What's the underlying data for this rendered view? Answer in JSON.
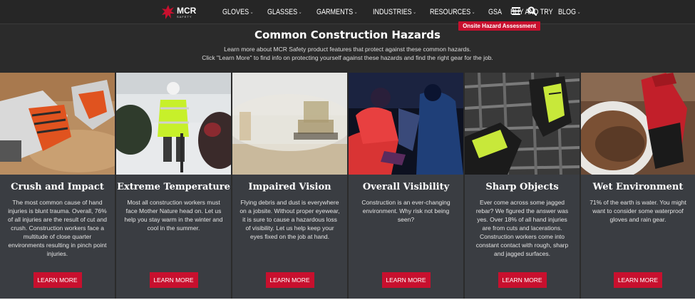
{
  "nav": {
    "logo": {
      "main": "MCR",
      "sub": "SAFETY"
    },
    "items": [
      {
        "label": "GLOVES",
        "has_dropdown": true
      },
      {
        "label": "GLASSES",
        "has_dropdown": true
      },
      {
        "label": "GARMENTS",
        "has_dropdown": true
      },
      {
        "label": "INDUSTRIES",
        "has_dropdown": true
      },
      {
        "label": "RESOURCES",
        "has_dropdown": true
      },
      {
        "label": "GSA",
        "has_dropdown": false
      },
      {
        "label": "BUY AND TRY",
        "has_dropdown": false
      },
      {
        "label": "BLOG",
        "has_dropdown": true
      }
    ],
    "icons": [
      "hamburger-menu-icon",
      "search-icon"
    ],
    "onsite_button": "Onsite Hazard Assessment"
  },
  "header": {
    "title": "Common Construction Hazards",
    "subtitle_1": "Learn more about MCR Safety product features that protect against these common hazards.",
    "subtitle_2": "Click \"Learn More\" to find info on protecting yourself against these hazards and find the right gear for the job."
  },
  "cards": [
    {
      "title": "Crush and Impact",
      "desc": "The most common cause of hand injuries is blunt trauma. Overall, 76% of all injuries are the result of cut and crush. Construction workers face a multitude of close quarter environments resulting in pinch point injuries.",
      "button": "LEARN MORE"
    },
    {
      "title": "Extreme Temperature",
      "desc": "Most all construction workers must face Mother Nature head on. Let us help you stay warm in the winter and cool in the summer.",
      "button": "LEARN MORE"
    },
    {
      "title": "Impaired Vision",
      "desc": "Flying debris and dust is everywhere on a jobsite. Without proper eyewear, it is sure to cause a hazardous loss of visibility. Let us help keep your eyes fixed on the job at hand.",
      "button": "LEARN MORE"
    },
    {
      "title": "Overall Visibility",
      "desc": "Construction is an ever-changing environment. Why risk not being seen?",
      "button": "LEARN MORE"
    },
    {
      "title": "Sharp Objects",
      "desc": "Ever come across some jagged rebar? We figured the answer was yes. Over 18% of all hand injuries are from cuts and lacerations. Construction workers come into constant contact with rough, sharp and jagged surfaces.",
      "button": "LEARN MORE"
    },
    {
      "title": "Wet Environment",
      "desc": "71% of the earth is water. You might want to consider some waterproof gloves and rain gear.",
      "button": "LEARN MORE"
    }
  ],
  "colors": {
    "accent": "#c8102e",
    "card_bg": "#3a3d42",
    "page_bg": "#2b2b2b"
  }
}
